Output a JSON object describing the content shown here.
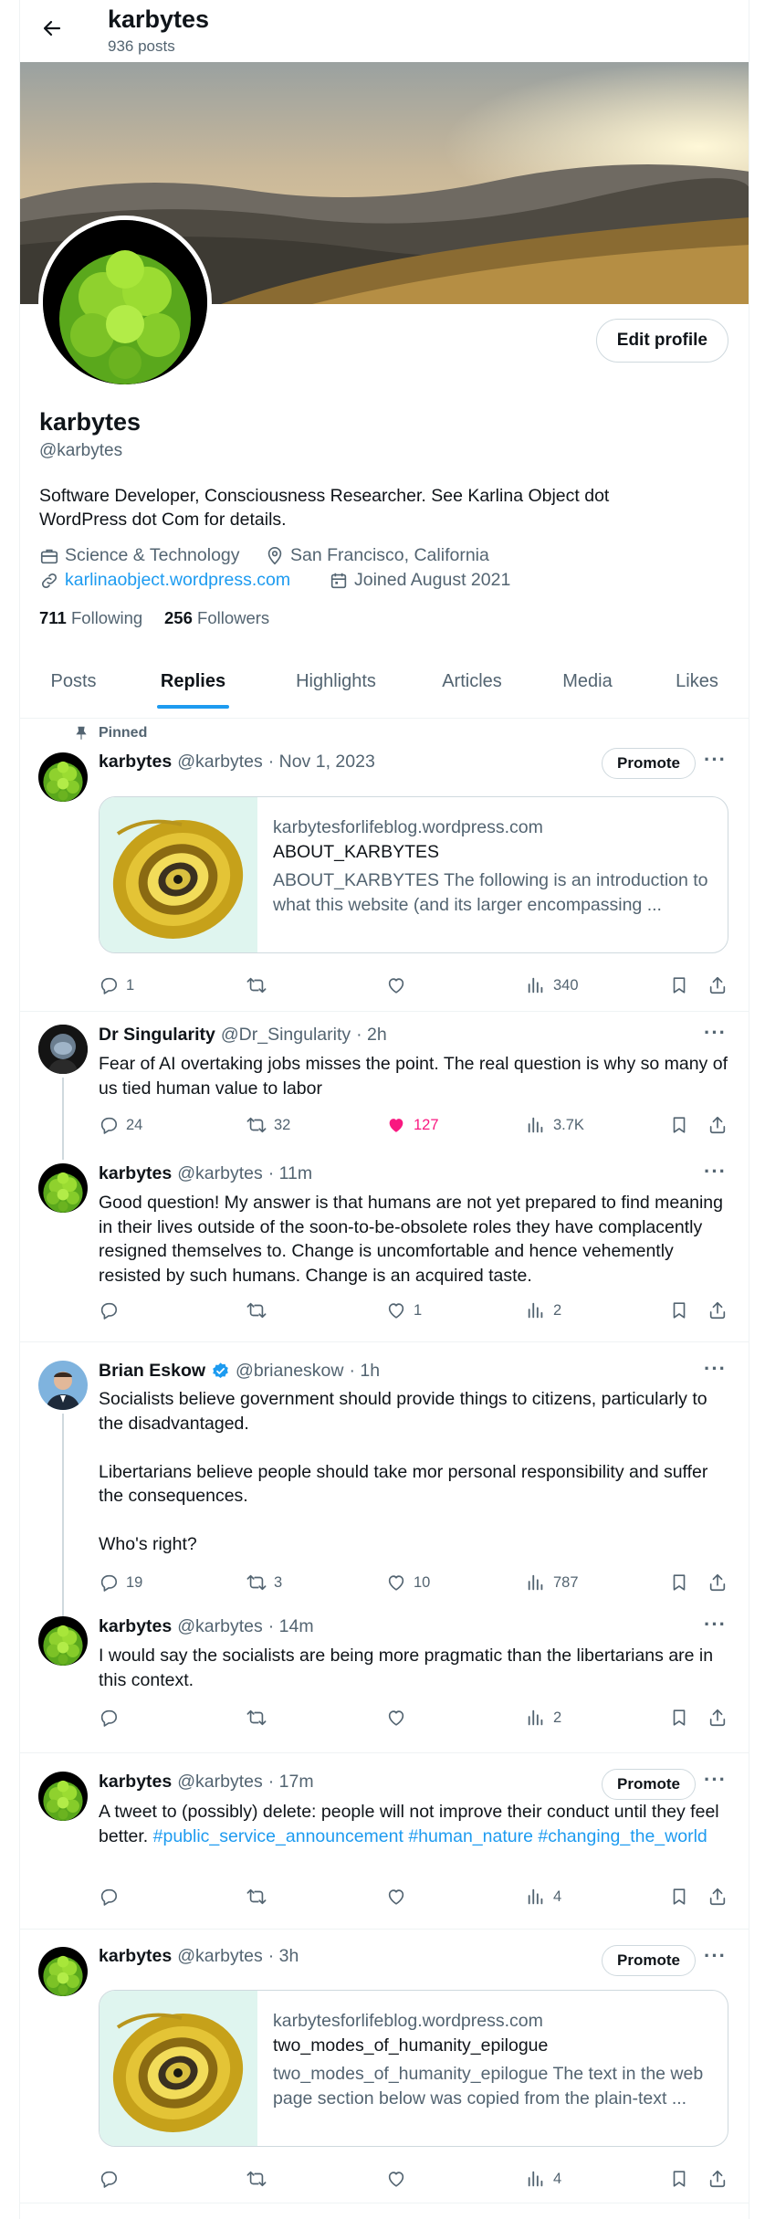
{
  "header": {
    "title": "karbytes",
    "posts": "936 posts"
  },
  "profile": {
    "name": "karbytes",
    "handle": "@karbytes",
    "edit_label": "Edit profile",
    "bio": "Software Developer, Consciousness Researcher. See Karlina Object dot WordPress dot Com for details.",
    "category": "Science & Technology",
    "location": "San Francisco, California",
    "website": "karlinaobject.wordpress.com",
    "joined": "Joined August 2021",
    "following_count": "711",
    "following_label": "Following",
    "followers_count": "256",
    "followers_label": "Followers"
  },
  "tabs": [
    "Posts",
    "Replies",
    "Highlights",
    "Articles",
    "Media",
    "Likes"
  ],
  "active_tab": "Replies",
  "pinned_label": "Pinned",
  "promote_label": "Promote",
  "tweets": [
    {
      "name": "karbytes",
      "handle": "@karbytes",
      "time": "· Nov 1, 2023",
      "card": {
        "domain": "karbytesforlifeblog.wordpress.com",
        "title": "ABOUT_KARBYTES",
        "desc": "ABOUT_KARBYTES The following is an introduction to what this website (and its larger encompassing ..."
      },
      "replies": "1",
      "reposts": "",
      "likes": "",
      "views": "340"
    },
    {
      "name": "Dr Singularity",
      "handle": "@Dr_Singularity",
      "time": "· 2h",
      "text": "Fear of AI overtaking jobs misses the point. The real question is why so many of us tied human value to labor",
      "replies": "24",
      "reposts": "32",
      "likes": "127",
      "views": "3.7K"
    },
    {
      "name": "karbytes",
      "handle": "@karbytes",
      "time": "· 11m",
      "text": "Good question! My answer is that humans are not yet prepared to find meaning in their lives outside of the soon-to-be-obsolete roles they have complacently resigned themselves to. Change is uncomfortable and hence vehemently resisted by such humans. Change is an acquired taste.",
      "replies": "",
      "reposts": "",
      "likes": "1",
      "views": "2"
    },
    {
      "name": "Brian Eskow",
      "handle": "@brianeskow",
      "time": "· 1h",
      "text": "Socialists believe government should provide things to citizens, particularly to the disadvantaged.\n\nLibertarians believe people should take mor personal responsibility and suffer the consequences.\n\nWho's right?",
      "replies": "19",
      "reposts": "3",
      "likes": "10",
      "views": "787"
    },
    {
      "name": "karbytes",
      "handle": "@karbytes",
      "time": "· 14m",
      "text": "I would say the socialists are being more pragmatic than the libertarians are in this context.",
      "replies": "",
      "reposts": "",
      "likes": "",
      "views": "2"
    },
    {
      "name": "karbytes",
      "handle": "@karbytes",
      "time": "· 17m",
      "text_a": "A tweet to (possibly) delete: people will not improve their conduct until they feel better. ",
      "tag1": "#public_service_announcement",
      "tag2": "#human_nature",
      "tag3": "#changing_the_world",
      "replies": "",
      "reposts": "",
      "likes": "",
      "views": "4"
    },
    {
      "name": "karbytes",
      "handle": "@karbytes",
      "time": "· 3h",
      "card": {
        "domain": "karbytesforlifeblog.wordpress.com",
        "title": "two_modes_of_humanity_epilogue",
        "desc": "two_modes_of_humanity_epilogue The text in the web page section below was copied from the plain-text ..."
      },
      "replies": "",
      "reposts": "",
      "likes": "",
      "views": "4"
    }
  ],
  "colors": {
    "accent": "#1d9bf0",
    "like": "#f91880",
    "verified": "#1d9bf0"
  }
}
